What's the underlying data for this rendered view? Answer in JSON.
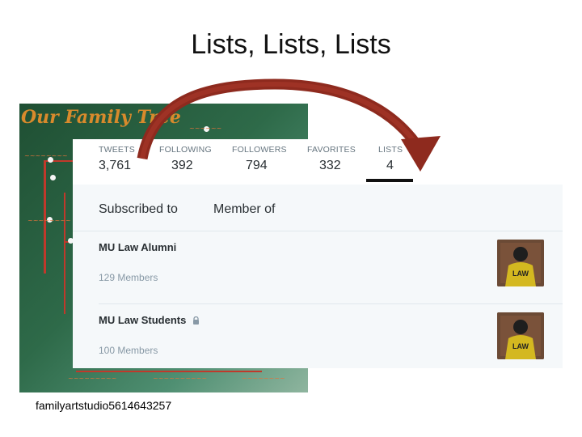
{
  "slide": {
    "title": "Lists, Lists, Lists"
  },
  "tree": {
    "title": "Our Family Tree",
    "caption": "familyartstudio5614643257"
  },
  "profile": {
    "stats": [
      {
        "label": "TWEETS",
        "value": "3,761"
      },
      {
        "label": "FOLLOWING",
        "value": "392"
      },
      {
        "label": "FOLLOWERS",
        "value": "794"
      },
      {
        "label": "FAVORITES",
        "value": "332"
      },
      {
        "label": "LISTS",
        "value": "4"
      }
    ],
    "tabs": {
      "subscribed": "Subscribed to",
      "member": "Member of"
    },
    "lists": [
      {
        "name": "MU Law Alumni",
        "members": "129 Members"
      },
      {
        "name": "MU Law Students",
        "members": "100 Members"
      }
    ],
    "avatar_text": "LAW"
  },
  "colors": {
    "arrow": "#8e2a1e",
    "tree_bg": "#2e6a49",
    "tree_title": "#d88a2c",
    "underline": "#111111"
  }
}
